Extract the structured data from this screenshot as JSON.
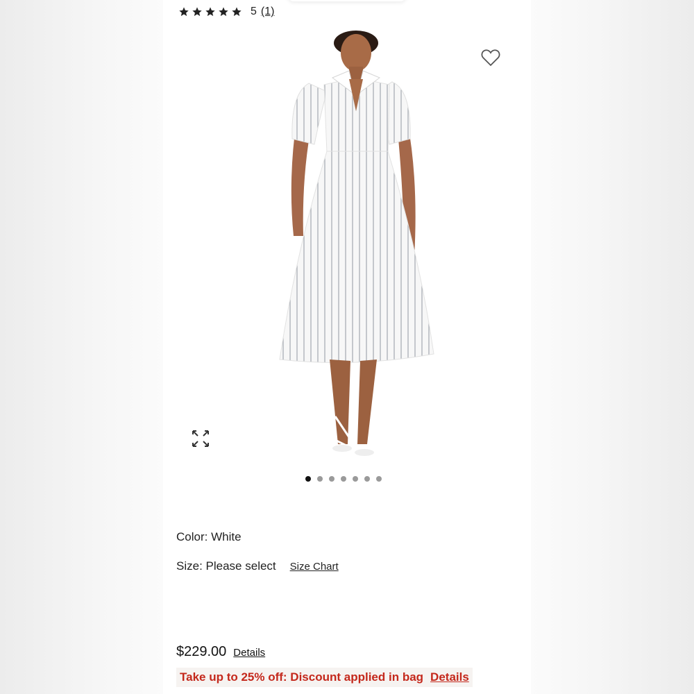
{
  "rating": {
    "stars": 5,
    "score_text": "5",
    "count_text": "(1)"
  },
  "product": {
    "color_label": "Color:",
    "color_value": "White",
    "size_label": "Size:",
    "size_value": "Please select",
    "size_chart_label": "Size Chart"
  },
  "carousel": {
    "dot_count": 7,
    "active_index": 0
  },
  "price": {
    "amount": "$229.00",
    "details_label": "Details"
  },
  "promo": {
    "text": "Take up to 25% off: Discount applied in bag",
    "details_label": "Details",
    "color": "#c4281c"
  },
  "icons": [
    "star-icon",
    "heart-icon",
    "expand-icon"
  ]
}
